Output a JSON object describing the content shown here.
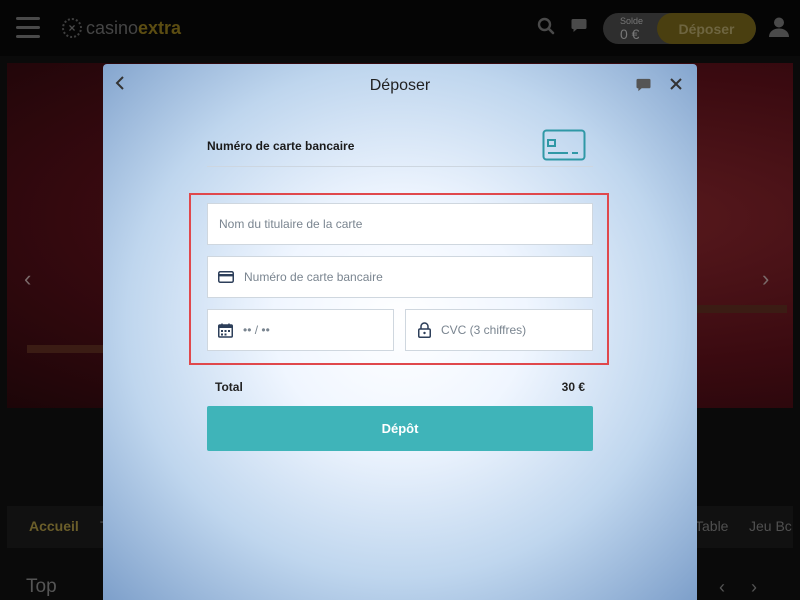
{
  "header": {
    "logo_part1": "casino",
    "logo_part2": "extra",
    "balance_label": "Solde",
    "balance_value": "0 €",
    "deposit_label": "Déposer"
  },
  "nav": {
    "tabs": [
      "Accueil",
      "T",
      "Table",
      "Jeu Bc"
    ],
    "section_title": "Top"
  },
  "modal": {
    "title": "Déposer",
    "card_type_label": "Numéro de carte bancaire",
    "form": {
      "cardholder_placeholder": "Nom du titulaire de la carte",
      "card_number_placeholder": "Numéro de carte bancaire",
      "expiry_placeholder": "•• / ••",
      "cvc_placeholder": "CVC (3 chiffres)"
    },
    "total_label": "Total",
    "total_value": "30 €",
    "submit_label": "Dépôt"
  },
  "colors": {
    "accent_teal": "#3fb4b9",
    "highlight_red": "#e0484c",
    "brand_gold": "#5c4d12"
  },
  "icons": {
    "menu": "hamburger-icon",
    "search": "search-icon",
    "chat": "chat-icon",
    "user": "user-icon",
    "back": "chevron-left-icon",
    "close": "close-icon",
    "card": "credit-card-icon",
    "calendar": "calendar-icon",
    "lock": "lock-icon"
  }
}
